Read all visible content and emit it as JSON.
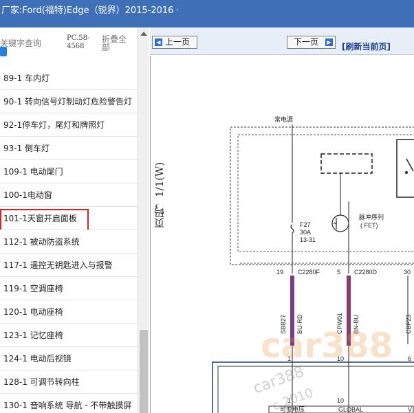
{
  "window": {
    "title": "厂家:Ford(福特)Edge（锐界）2015-2016",
    "title_dot": "."
  },
  "search": {
    "keyword_label": "关键字查询",
    "pc_number": "PC.58-4568",
    "fold_all": "折叠全部"
  },
  "list": {
    "items": [
      "89-1 车内灯",
      "90-1 转向信号灯制动灯危险警告灯",
      "92-1停车灯，尾灯和牌照灯",
      "93-1 倒车灯",
      "109-1 电动尾门",
      "100-1电动窗",
      "101-1天窗开启面板",
      "112-1 被动防盗系统",
      "117-1 遥控无钥匙进入与报警",
      "119-1 空调座椅",
      "120-1 电动座椅",
      "123-1 记忆座椅",
      "124-1 电动后视镜",
      "128-1 可调节转向柱",
      "130-1 音响系统 导航 - 不带触摸屏"
    ],
    "highlighted_index": 6
  },
  "toolbar": {
    "prev_label": "上一页",
    "next_label": "下一页",
    "refresh_label": "[刷新当前页]"
  },
  "diagram": {
    "page_label": "页码，1/1(W)",
    "power_label": "常电源",
    "fuse": {
      "name": "F27",
      "rating": "30A",
      "ref": "13-31"
    },
    "pulse_label": "脉冲序列",
    "fet_label": "( FET)",
    "connector_left": "C2280F",
    "connector_right": "C2280D",
    "pin_left": "19",
    "pin_mid": "5",
    "pin_right": "30",
    "wire1_code": "SBB27",
    "wire1_color": "BU-RD",
    "wire2_code": "CPW01",
    "wire2_color": "BN-BU",
    "wire3_code": "CBP23",
    "lower_pin1": "1",
    "lower_pin2": "10",
    "lower_pin3": "6",
    "bottom_label1": "可变电压",
    "bottom_label2": "GLOBAL",
    "bottom_label3": "V",
    "watermark": "car388",
    "watermark2": "car388",
    "watermark_year": "c 2010"
  }
}
